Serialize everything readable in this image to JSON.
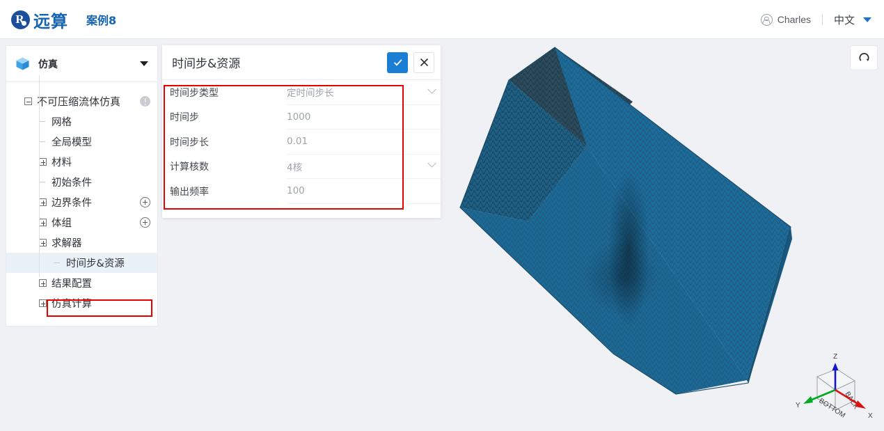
{
  "topbar": {
    "brand_name": "远算",
    "brand_glyph": "R",
    "case_title": "案例8",
    "user_name": "Charles",
    "language": "中文",
    "avatar_icon": "user-circle-icon",
    "lang_caret_icon": "caret-down-icon",
    "accent_color": "#1664b4"
  },
  "sidebar": {
    "header": {
      "title": "仿真",
      "cube_icon": "cube-icon",
      "caret_icon": "caret-down-icon"
    },
    "tree": [
      {
        "label": "不可压缩流体仿真",
        "toggle": "minus",
        "level": 0,
        "badge": "warning-icon",
        "selected": false
      },
      {
        "label": "网格",
        "toggle": "leaf",
        "level": 1,
        "badge": "",
        "selected": false
      },
      {
        "label": "全局模型",
        "toggle": "leaf",
        "level": 1,
        "badge": "",
        "selected": false
      },
      {
        "label": "材料",
        "toggle": "plus",
        "level": 1,
        "badge": "",
        "selected": false
      },
      {
        "label": "初始条件",
        "toggle": "leaf",
        "level": 1,
        "badge": "",
        "selected": false
      },
      {
        "label": "边界条件",
        "toggle": "plus",
        "level": 1,
        "badge": "add-icon",
        "selected": false
      },
      {
        "label": "体组",
        "toggle": "plus",
        "level": 1,
        "badge": "add-icon",
        "selected": false
      },
      {
        "label": "求解器",
        "toggle": "plus",
        "level": 1,
        "badge": "",
        "selected": false
      },
      {
        "label": "时间步&资源",
        "toggle": "leaf",
        "level": 2,
        "badge": "",
        "selected": true
      },
      {
        "label": "结果配置",
        "toggle": "plus",
        "level": 1,
        "badge": "",
        "selected": false
      },
      {
        "label": "仿真计算",
        "toggle": "plus",
        "level": 1,
        "badge": "",
        "selected": false
      }
    ],
    "highlight_color": "#e60000"
  },
  "panel": {
    "title": "时间步&资源",
    "confirm_icon": "check-icon",
    "close_icon": "close-icon",
    "confirm_color": "#1a7fd4",
    "highlight_color": "#e60000",
    "fields": [
      {
        "label": "时间步类型",
        "value": "定时间步长",
        "control": "select",
        "chevron_icon": "chevron-down-icon"
      },
      {
        "label": "时间步",
        "value": "1000",
        "control": "input",
        "chevron_icon": ""
      },
      {
        "label": "时间步长",
        "value": "0.01",
        "control": "input",
        "chevron_icon": ""
      },
      {
        "label": "计算核数",
        "value": "4核",
        "control": "select",
        "chevron_icon": "chevron-down-icon"
      },
      {
        "label": "输出频率",
        "value": "100",
        "control": "input",
        "chevron_icon": ""
      }
    ]
  },
  "viewport": {
    "reset_button_icon": "reset-view-icon",
    "mesh_color": "#1c6e9e",
    "mesh_edge_color": "#2d4a5c",
    "background_color": "#f0f1f5",
    "gizmo": {
      "axes": [
        {
          "name": "Z",
          "color": "#1414cc"
        },
        {
          "name": "Y",
          "color": "#00aa22"
        },
        {
          "name": "X",
          "color": "#dd1111"
        }
      ],
      "cube_faces": [
        "BACK",
        "BOTTOM"
      ]
    }
  }
}
